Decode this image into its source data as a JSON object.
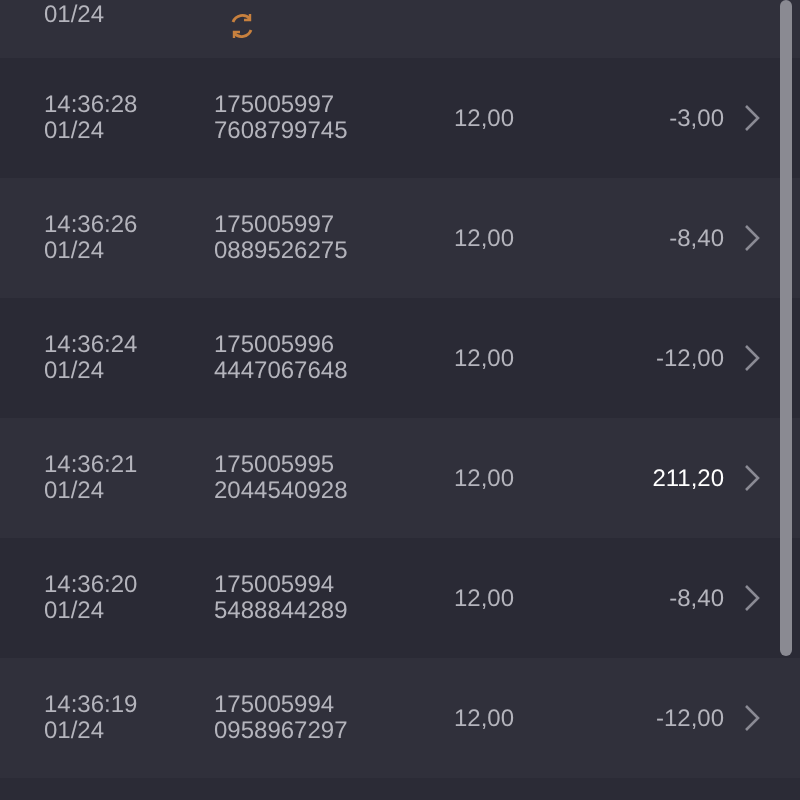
{
  "partial_row": {
    "date": "01/24",
    "pending": true
  },
  "rows": [
    {
      "time": "14:36:28",
      "date": "01/24",
      "id_line_1": "175005997",
      "id_line_2": "7608799745",
      "bet": "12,00",
      "result": "-3,00",
      "highlighted": false
    },
    {
      "time": "14:36:26",
      "date": "01/24",
      "id_line_1": "175005997",
      "id_line_2": "0889526275",
      "bet": "12,00",
      "result": "-8,40",
      "highlighted": false
    },
    {
      "time": "14:36:24",
      "date": "01/24",
      "id_line_1": "175005996",
      "id_line_2": "4447067648",
      "bet": "12,00",
      "result": "-12,00",
      "highlighted": false
    },
    {
      "time": "14:36:21",
      "date": "01/24",
      "id_line_1": "175005995",
      "id_line_2": "2044540928",
      "bet": "12,00",
      "result": "211,20",
      "highlighted": true
    },
    {
      "time": "14:36:20",
      "date": "01/24",
      "id_line_1": "175005994",
      "id_line_2": "5488844289",
      "bet": "12,00",
      "result": "-8,40",
      "highlighted": false
    },
    {
      "time": "14:36:19",
      "date": "01/24",
      "id_line_1": "175005994",
      "id_line_2": "0958967297",
      "bet": "12,00",
      "result": "-12,00",
      "highlighted": false
    }
  ]
}
